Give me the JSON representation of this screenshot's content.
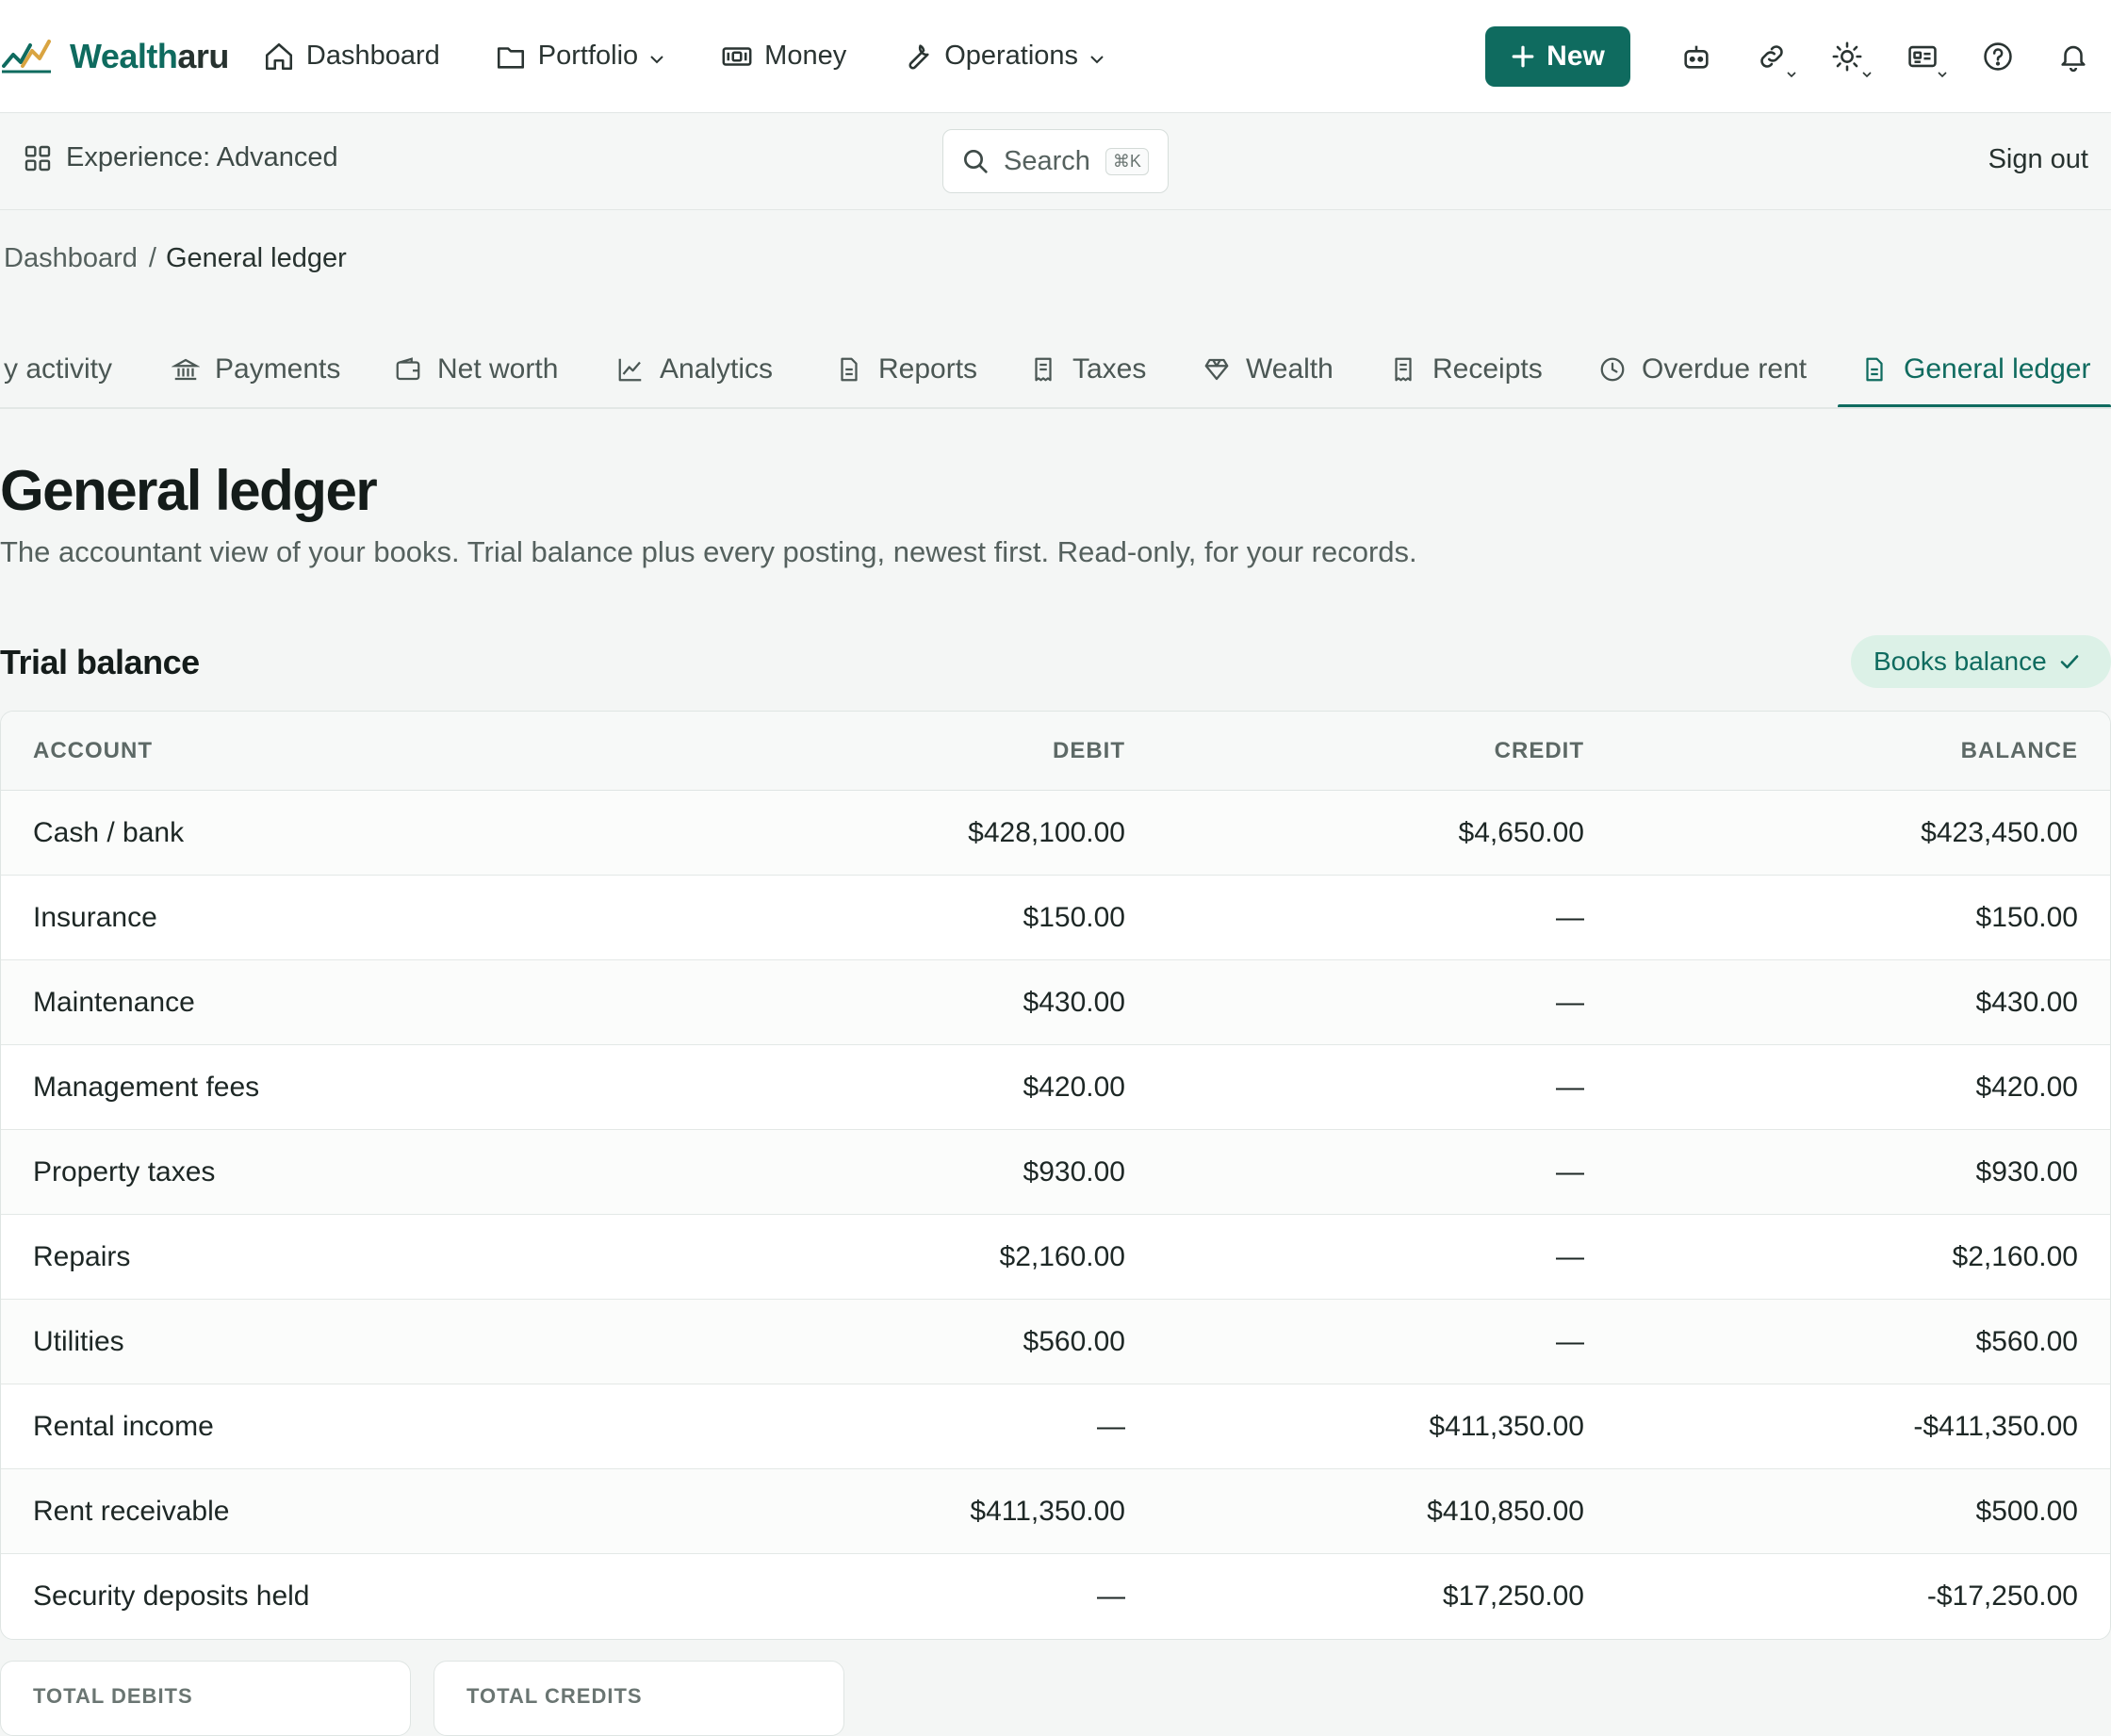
{
  "brand": {
    "name_a": "Wealth",
    "name_b": "aru"
  },
  "nav": [
    {
      "label": "Dashboard",
      "icon": "home-icon"
    },
    {
      "label": "Portfolio",
      "icon": "folder-icon",
      "dropdown": true
    },
    {
      "label": "Money",
      "icon": "banknote-icon"
    },
    {
      "label": "Operations",
      "icon": "wrench-icon",
      "dropdown": true
    }
  ],
  "toolbar": {
    "new_label": "New",
    "tools": [
      "bot-icon",
      "link-icon",
      "sun-icon",
      "id-card-icon",
      "help-icon",
      "bell-icon"
    ]
  },
  "subbar": {
    "experience": "Experience: Advanced",
    "search_placeholder": "Search",
    "search_shortcut": "⌘K",
    "sign_out": "Sign out"
  },
  "breadcrumb": {
    "parent": "Dashboard",
    "separator": "/",
    "current": "General ledger"
  },
  "tabs": [
    {
      "label": "y activity",
      "icon": ""
    },
    {
      "label": "Payments",
      "icon": "bank-icon"
    },
    {
      "label": "Net worth",
      "icon": "wallet-icon"
    },
    {
      "label": "Analytics",
      "icon": "line-chart-icon"
    },
    {
      "label": "Reports",
      "icon": "document-icon"
    },
    {
      "label": "Taxes",
      "icon": "receipt-icon"
    },
    {
      "label": "Wealth",
      "icon": "gem-icon"
    },
    {
      "label": "Receipts",
      "icon": "receipt-icon"
    },
    {
      "label": "Overdue rent",
      "icon": "clock-icon"
    },
    {
      "label": "General ledger",
      "icon": "document-icon",
      "active": true
    }
  ],
  "page": {
    "title": "General ledger",
    "subtitle": "The accountant view of your books. Trial balance plus every posting, newest first. Read-only, for your records."
  },
  "trial_balance": {
    "title": "Trial balance",
    "status": "Books balance",
    "columns": {
      "account": "ACCOUNT",
      "debit": "DEBIT",
      "credit": "CREDIT",
      "balance": "BALANCE"
    },
    "rows": [
      {
        "account": "Cash / bank",
        "debit": "$428,100.00",
        "credit": "$4,650.00",
        "balance": "$423,450.00"
      },
      {
        "account": "Insurance",
        "debit": "$150.00",
        "credit": "—",
        "balance": "$150.00"
      },
      {
        "account": "Maintenance",
        "debit": "$430.00",
        "credit": "—",
        "balance": "$430.00"
      },
      {
        "account": "Management fees",
        "debit": "$420.00",
        "credit": "—",
        "balance": "$420.00"
      },
      {
        "account": "Property taxes",
        "debit": "$930.00",
        "credit": "—",
        "balance": "$930.00"
      },
      {
        "account": "Repairs",
        "debit": "$2,160.00",
        "credit": "—",
        "balance": "$2,160.00"
      },
      {
        "account": "Utilities",
        "debit": "$560.00",
        "credit": "—",
        "balance": "$560.00"
      },
      {
        "account": "Rental income",
        "debit": "—",
        "credit": "$411,350.00",
        "balance": "-$411,350.00"
      },
      {
        "account": "Rent receivable",
        "debit": "$411,350.00",
        "credit": "$410,850.00",
        "balance": "$500.00"
      },
      {
        "account": "Security deposits held",
        "debit": "—",
        "credit": "$17,250.00",
        "balance": "-$17,250.00"
      }
    ],
    "totals": {
      "debits_label": "TOTAL DEBITS",
      "credits_label": "TOTAL CREDITS"
    }
  },
  "colors": {
    "accent": "#0f6b5f",
    "badge_bg": "#dcf1e7",
    "page_bg": "#f4f6f5"
  }
}
